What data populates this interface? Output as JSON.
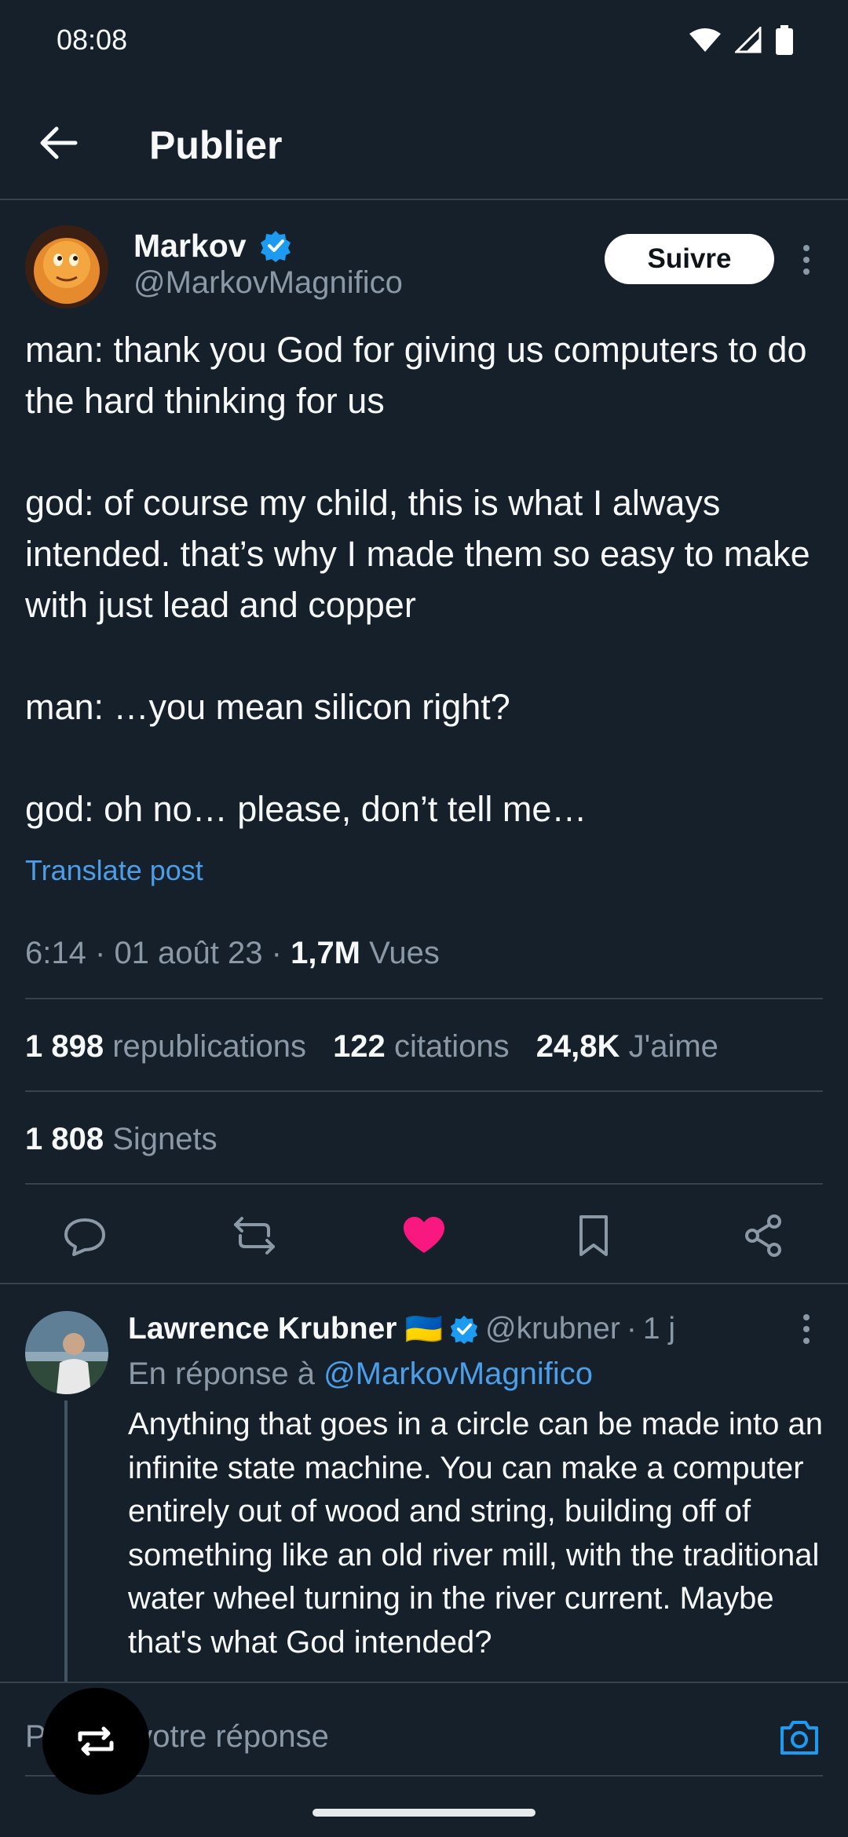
{
  "status_bar": {
    "time": "08:08"
  },
  "header": {
    "title": "Publier"
  },
  "post": {
    "author_name": "Markov",
    "author_handle": "@MarkovMagnifico",
    "follow_label": "Suivre",
    "paragraphs": [
      "man: thank you God for giving us computers to do the hard thinking for us",
      "god: of course my child, this is what I always intended. that’s why I made them so easy to make with just lead and copper",
      "man: …you mean silicon right?",
      "god: oh no… please, don’t tell me…"
    ],
    "translate_label": "Translate post",
    "meta": {
      "time": "6:14",
      "date": "01 août 23",
      "views_count": "1,7M",
      "views_label": "Vues"
    },
    "stats": {
      "reposts_count": "1 898",
      "reposts_label": "republications",
      "quotes_count": "122",
      "quotes_label": "citations",
      "likes_count": "24,8K",
      "likes_label": "J'aime",
      "bookmarks_count": "1 808",
      "bookmarks_label": "Signets"
    }
  },
  "reply": {
    "author_name": "Lawrence Krubner",
    "flag": "🇺🇦",
    "author_handle": "@krubner",
    "age": "1 j",
    "replying_prefix": "En réponse à",
    "replying_to": "@MarkovMagnifico",
    "text": "Anything that goes in a circle can be made into an infinite state machine. You can make a computer entirely out of wood and string, building off of something like an old river mill, with the traditional water wheel turning in the river current. Maybe that's what God intended?"
  },
  "composer": {
    "placeholder": "Publiez votre réponse"
  },
  "colors": {
    "background": "#15202b",
    "accent": "#1d9bf0",
    "like": "#f91880",
    "muted": "#8b98a5"
  }
}
